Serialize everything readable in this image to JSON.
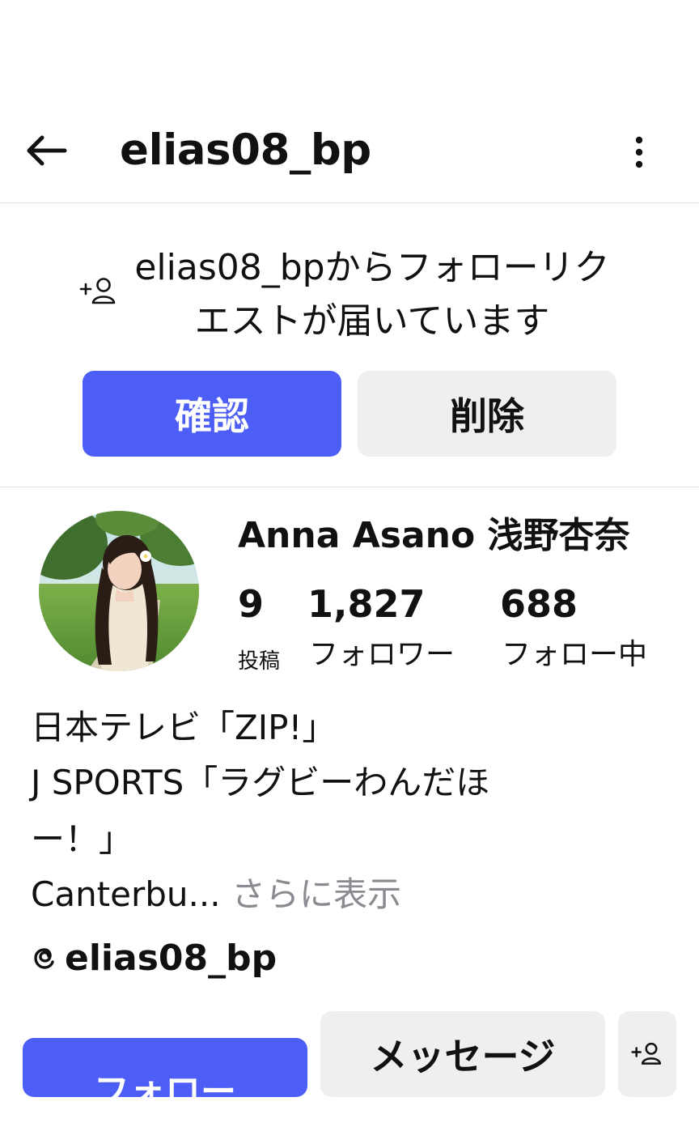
{
  "header": {
    "username": "elias08_bp",
    "back_icon": "arrow-left-icon",
    "more_icon": "vertical-ellipsis-icon"
  },
  "follow_request": {
    "icon": "add-person-icon",
    "message": "elias08_bpからフォローリクエストが届いています",
    "confirm_label": "確認",
    "delete_label": "削除"
  },
  "profile": {
    "display_name": "Anna Asano 浅野杏奈",
    "stats": [
      {
        "value": "9",
        "label": "投稿"
      },
      {
        "value": "1,827",
        "label": "フォロワー"
      },
      {
        "value": "688",
        "label": "フォロー中"
      }
    ],
    "bio_lines": [
      "日本テレビ「ZIP!」",
      "J SPORTS「ラグビーわんだほ",
      "ー！」",
      "Canterbu..."
    ],
    "bio_more": "さらに表示",
    "threads_icon": "threads-icon",
    "threads_handle": "elias08_bp"
  },
  "actions": {
    "follow_label": "フォロー",
    "message_label": "メッセージ",
    "suggest_icon": "add-person-icon"
  },
  "colors": {
    "primary": "#4d5ef7",
    "secondary_bg": "#efeff2",
    "muted_text": "#8a8a90",
    "divider": "#e3e3e6"
  }
}
